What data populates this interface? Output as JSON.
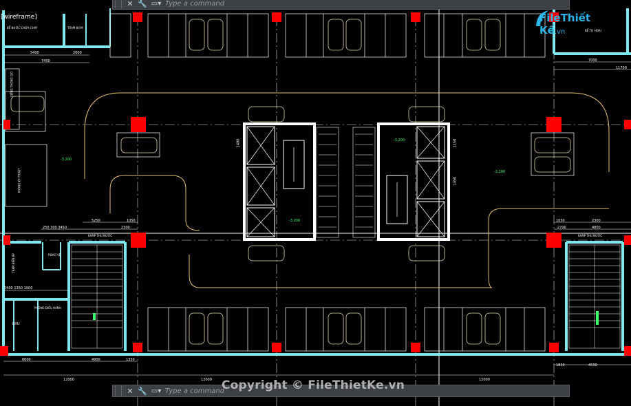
{
  "viewport": {
    "label": "[wireframe]"
  },
  "command_line": {
    "close_glyph": "✕",
    "settings_glyph": "🔧",
    "prompt_glyph": "▭▾",
    "placeholder": "Type a command"
  },
  "brand": {
    "logo_text_1": "File",
    "logo_text_2": "Thiết Kế",
    "logo_suffix": ".vn",
    "watermark": "Copyright © FileThietKe.vn"
  },
  "colors": {
    "wall": "#7de8f0",
    "column": "#ff0000",
    "drive_line": "#e8c070",
    "parking": "#ffffff",
    "dim": "#ffffff",
    "text_green": "#3cff6a",
    "grid": "#ffffff"
  },
  "labels": {
    "room_pccc": "BỂ NƯỚC CHỮA CHÁY",
    "room_pump": "TRẠM BƠM",
    "room_tuhoai": "BỂ TỰ HOẠI",
    "room_tong_gio": "GIẾNG THÔNG GIÓ",
    "room_bmc": "TRẠM BIẾN ÁP",
    "room_kt": "PHÒNG KỸ THUẬT",
    "room_ve": "P.BẢO VỆ",
    "room_dieu_hanh": "PHÒNG ĐIỀU HÀNH",
    "ramp_left": "RAMP THU NƯỚC",
    "ramp_right": "RAMP THU NƯỚC",
    "level_1": "-3.200",
    "level_2": "-3.200",
    "level_3": "-3.200",
    "level_4": "-3.200",
    "level_5": "-3.200",
    "level_6": "-3.200",
    "khu": "KHU"
  },
  "dimensions": {
    "d_5400": "5400",
    "d_2000": "2000",
    "d_7400": "7400",
    "d_7000": "7000",
    "d_11700": "11700",
    "d_5250": "5250",
    "d_1050": "1050",
    "d_2300": "2300",
    "d_250": "250",
    "d_3450": "3450",
    "d_300": "300",
    "d_1400": "1400",
    "d_1500": "1500",
    "d_1150": "1150",
    "d_1450": "1450",
    "d_6000": "6000",
    "d_4500": "4500",
    "d_1350": "1350",
    "d_1850": "1850",
    "d_4900": "4900",
    "d_12000a": "12000",
    "d_12000b": "12000",
    "d_12000c": "12000",
    "d_5400b": "5400",
    "d_1350b": "1350",
    "d_1050b": "1050",
    "d_2700": "2700",
    "d_4800": "4800",
    "d_2300b": "2300"
  }
}
